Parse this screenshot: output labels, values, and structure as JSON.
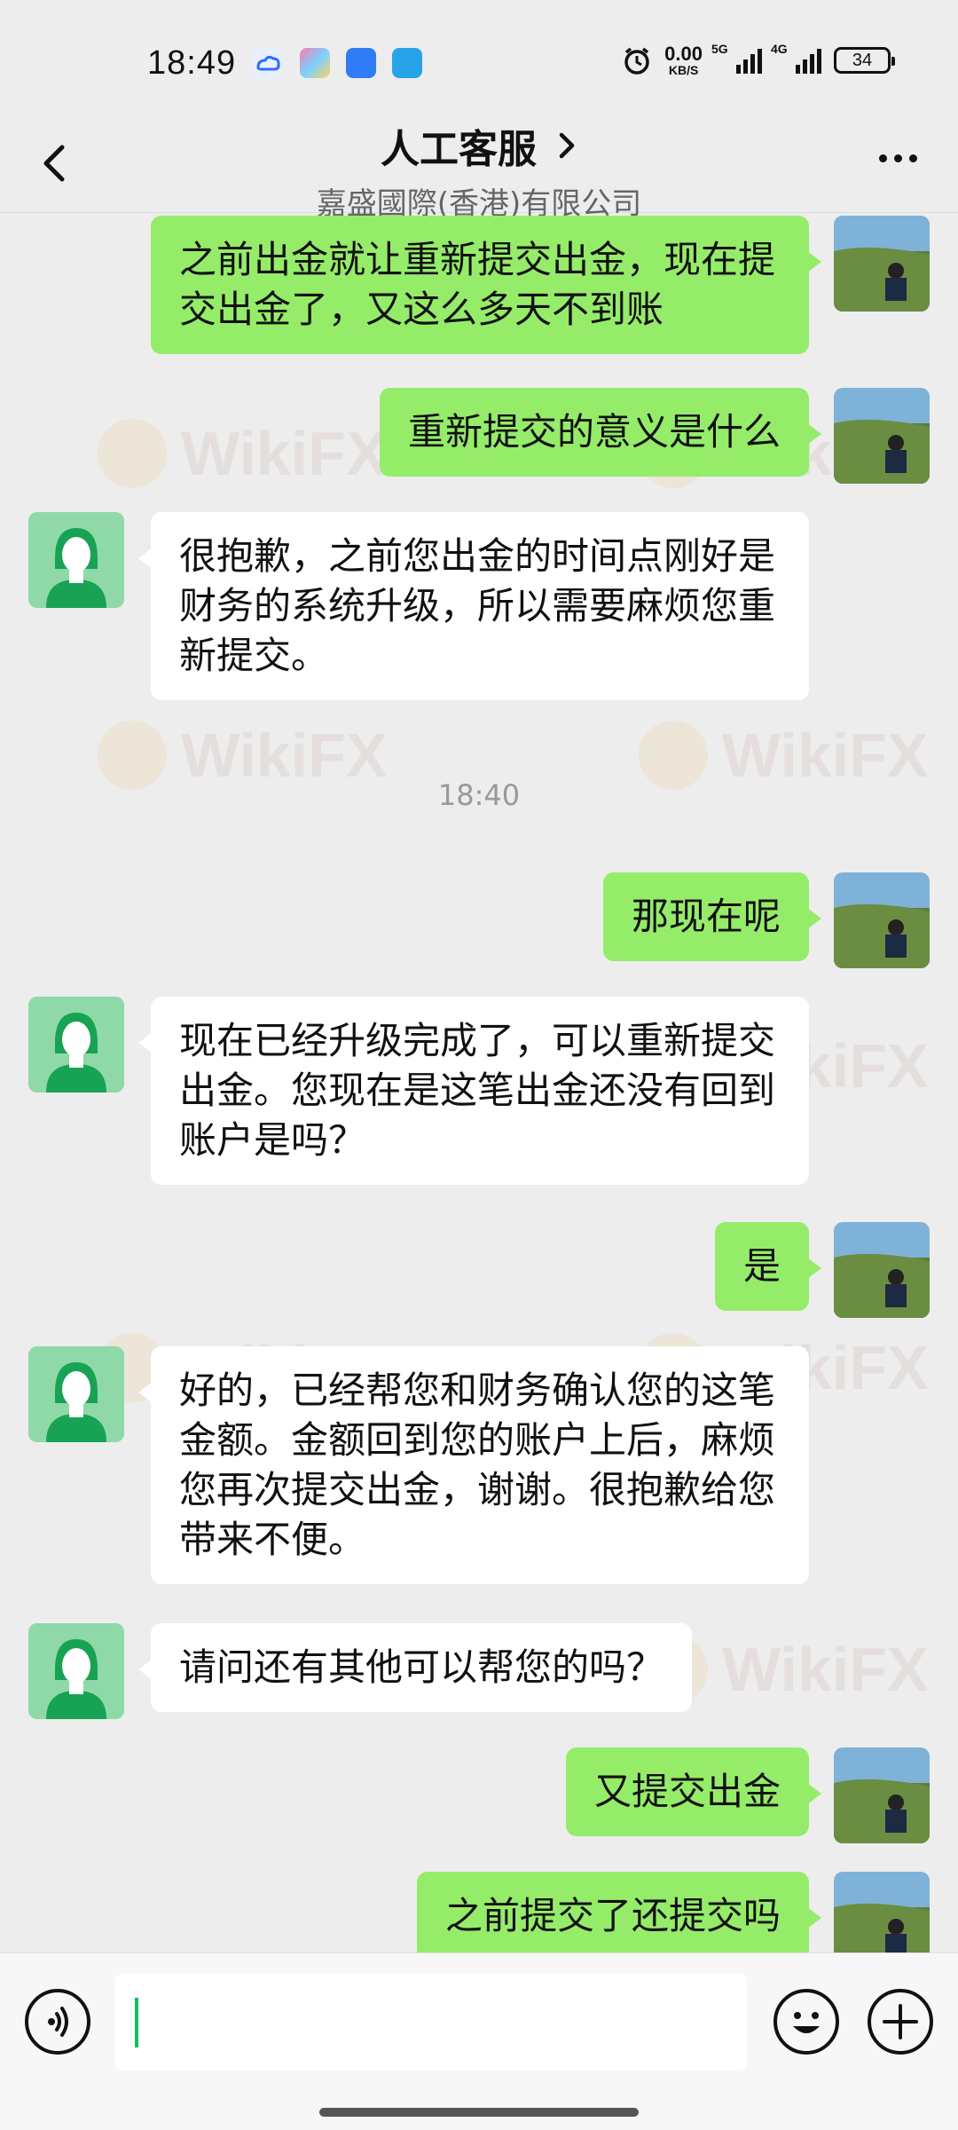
{
  "status_bar": {
    "time": "18:49",
    "net_speed_value": "0.00",
    "net_speed_unit": "KB/S",
    "sig1_label": "5G",
    "sig2_label": "4G",
    "battery": "34"
  },
  "header": {
    "title": "人工客服",
    "subtitle": "嘉盛國際(香港)有限公司"
  },
  "messages": [
    {
      "from": "me",
      "text": "之前出金就让重新提交出金，现在提交出金了，又这么多天不到账"
    },
    {
      "from": "me",
      "text": "重新提交的意义是什么"
    },
    {
      "from": "them",
      "text": "很抱歉，之前您出金的时间点刚好是财务的系统升级，所以需要麻烦您重新提交。"
    },
    {
      "from": "time",
      "text": "18:40"
    },
    {
      "from": "me",
      "text": "那现在呢"
    },
    {
      "from": "them",
      "text": "现在已经升级完成了，可以重新提交出金。您现在是这笔出金还没有回到账户是吗？"
    },
    {
      "from": "me",
      "text": "是"
    },
    {
      "from": "them",
      "text": "好的，已经帮您和财务确认您的这笔金额。金额回到您的账户上后，麻烦您再次提交出金，谢谢。很抱歉给您带来不便。"
    },
    {
      "from": "them",
      "text": "请问还有其他可以帮您的吗？"
    },
    {
      "from": "me",
      "text": "又提交出金"
    },
    {
      "from": "me",
      "text": "之前提交了还提交吗"
    }
  ],
  "watermark": "WikiFX",
  "colors": {
    "my_bubble": "#95ec69",
    "their_bubble": "#ffffff",
    "background": "#ededed",
    "cursor": "#07c160"
  }
}
